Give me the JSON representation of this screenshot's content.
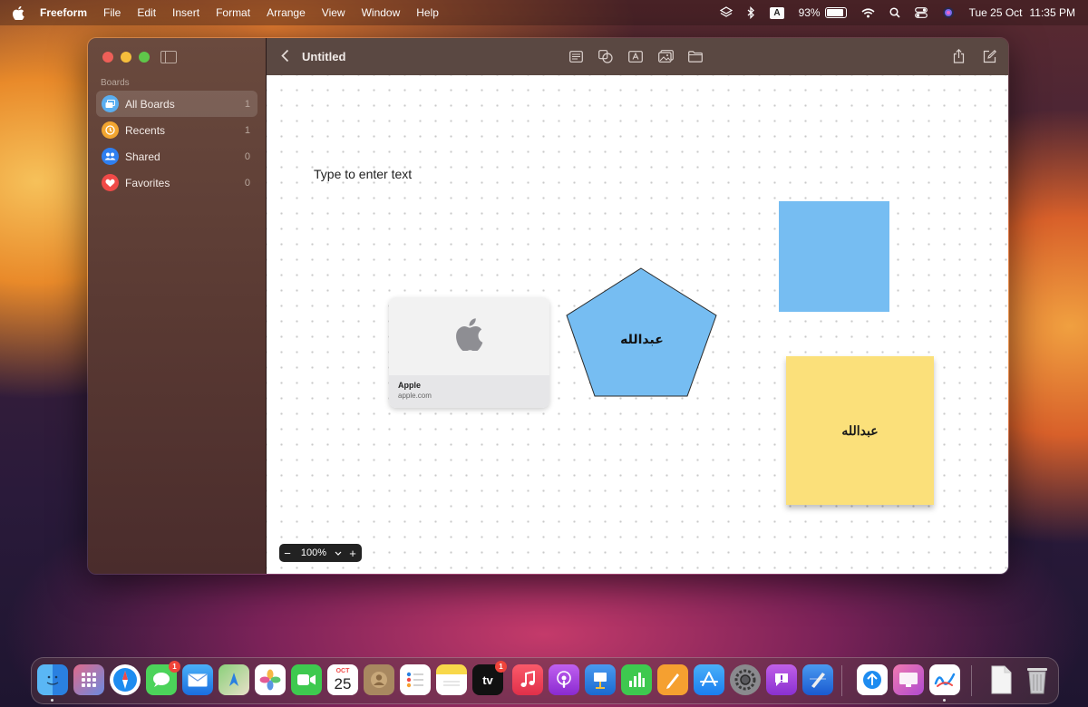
{
  "menubar": {
    "app_name": "Freeform",
    "menus": [
      "File",
      "Edit",
      "Insert",
      "Format",
      "Arrange",
      "View",
      "Window",
      "Help"
    ],
    "input_source": "A",
    "battery_percent": "93%",
    "date": "Tue 25 Oct",
    "time": "11:35 PM"
  },
  "sidebar": {
    "section_label": "Boards",
    "items": [
      {
        "label": "All Boards",
        "count": "1",
        "color": "#5aaef0",
        "icon": "boards-icon"
      },
      {
        "label": "Recents",
        "count": "1",
        "color": "#f2a530",
        "icon": "clock-icon"
      },
      {
        "label": "Shared",
        "count": "0",
        "color": "#2f7ff0",
        "icon": "people-icon"
      },
      {
        "label": "Favorites",
        "count": "0",
        "color": "#f04a48",
        "icon": "heart-icon"
      }
    ]
  },
  "toolbar": {
    "title": "Untitled"
  },
  "canvas": {
    "text_placeholder": "Type to enter text",
    "link_card": {
      "title": "Apple",
      "url": "apple.com"
    },
    "pentagon_text": "عبدالله",
    "sticky_text": "عبدالله",
    "shape_blue": "#76bdf2",
    "sticky_color": "#fbe07a",
    "zoom": "100%"
  },
  "dock": {
    "calendar_month": "OCT",
    "calendar_day": "25",
    "messages_badge": "1",
    "tv_badge": "1",
    "tv_label": "tv"
  }
}
